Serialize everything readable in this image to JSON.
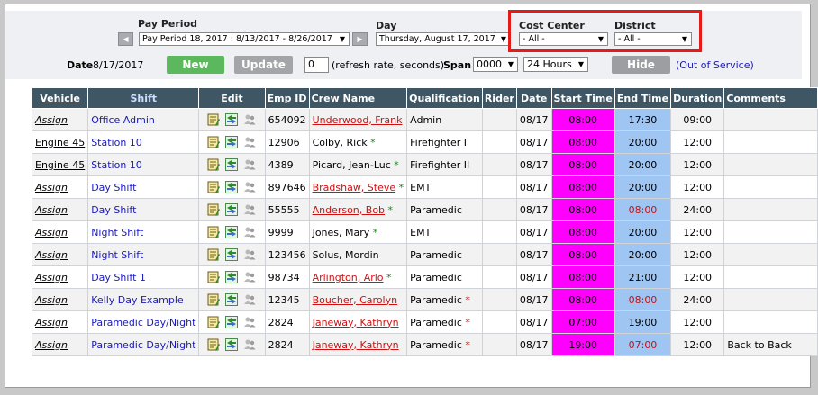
{
  "colors": {
    "start_bg": "#ff00ff",
    "end_bg": "#9fc5f2",
    "header_bg": "#3f5665",
    "accent_red": "#e31b1b"
  },
  "filters": {
    "pay_period_label": "Pay Period",
    "pay_period_value": "Pay Period 18, 2017 : 8/13/2017 - 8/26/2017",
    "day_label": "Day",
    "day_value": "Thursday, August 17, 2017",
    "cost_center_label": "Cost Center",
    "cost_center_value": "- All -",
    "district_label": "District",
    "district_value": "- All -",
    "prev_icon": "left-arrow-icon",
    "next_icon": "right-arrow-icon"
  },
  "controls": {
    "date_label": "Date",
    "date_value": "8/17/2017",
    "new_label": "New",
    "update_label": "Update",
    "refresh_value": "0",
    "refresh_text": "(refresh rate, seconds)",
    "span_label": "Span",
    "span_time": "0000",
    "span_hours": "24 Hours",
    "hide_label": "Hide",
    "out_of_service": "(Out of Service)"
  },
  "table": {
    "headers": [
      "Vehicle",
      "Shift",
      "Edit",
      "Emp ID",
      "Crew Name",
      "Qualification",
      "Rider",
      "Date",
      "Start Time",
      "End Time",
      "Duration",
      "Comments"
    ],
    "rows": [
      {
        "vehicle": "Assign",
        "shift": "Office Admin",
        "emp": "654092",
        "crew": "Underwood, Frank",
        "star": "",
        "qual": "Admin",
        "qstar": "",
        "date": "08/17",
        "start": "08:00",
        "end": "17:30",
        "dur": "09:00",
        "comment": ""
      },
      {
        "vehicle": "Engine 45",
        "shift": "Station 10",
        "emp": "12906",
        "crew": "Colby, Rick",
        "star": "*",
        "qual": "Firefighter I",
        "qstar": "",
        "date": "08/17",
        "start": "08:00",
        "end": "20:00",
        "dur": "12:00",
        "comment": ""
      },
      {
        "vehicle": "Engine 45",
        "shift": "Station 10",
        "emp": "4389",
        "crew": "Picard, Jean-Luc",
        "star": "*",
        "qual": "Firefighter II",
        "qstar": "",
        "date": "08/17",
        "start": "08:00",
        "end": "20:00",
        "dur": "12:00",
        "comment": ""
      },
      {
        "vehicle": "Assign",
        "shift": "Day Shift",
        "emp": "897646",
        "crew": "Bradshaw, Steve",
        "star": "*",
        "qual": "EMT",
        "qstar": "",
        "date": "08/17",
        "start": "08:00",
        "end": "20:00",
        "dur": "12:00",
        "comment": ""
      },
      {
        "vehicle": "Assign",
        "shift": "Day Shift",
        "emp": "55555",
        "crew": "Anderson, Bob",
        "star": "*",
        "qual": "Paramedic",
        "qstar": "",
        "date": "08/17",
        "start": "08:00",
        "end": "08:00",
        "dur": "24:00",
        "comment": ""
      },
      {
        "vehicle": "Assign",
        "shift": "Night Shift",
        "emp": "9999",
        "crew": "Jones, Mary",
        "star": "*",
        "qual": "EMT",
        "qstar": "",
        "date": "08/17",
        "start": "08:00",
        "end": "20:00",
        "dur": "12:00",
        "comment": ""
      },
      {
        "vehicle": "Assign",
        "shift": "Night Shift",
        "emp": "123456",
        "crew": "Solus, Mordin",
        "star": "",
        "qual": "Paramedic",
        "qstar": "",
        "date": "08/17",
        "start": "08:00",
        "end": "20:00",
        "dur": "12:00",
        "comment": ""
      },
      {
        "vehicle": "Assign",
        "shift": "Day Shift 1",
        "emp": "98734",
        "crew": "Arlington, Arlo",
        "star": "*",
        "qual": "Paramedic",
        "qstar": "",
        "date": "08/17",
        "start": "08:00",
        "end": "21:00",
        "dur": "12:00",
        "comment": ""
      },
      {
        "vehicle": "Assign",
        "shift": "Kelly Day Example",
        "emp": "12345",
        "crew": "Boucher, Carolyn",
        "star": "",
        "qual": "Paramedic",
        "qstar": "*",
        "date": "08/17",
        "start": "08:00",
        "end": "08:00",
        "dur": "24:00",
        "comment": ""
      },
      {
        "vehicle": "Assign",
        "shift": "Paramedic Day/Night",
        "emp": "2824",
        "crew": "Janeway, Kathryn",
        "star": "",
        "qual": "Paramedic",
        "qstar": "*",
        "date": "08/17",
        "start": "07:00",
        "end": "19:00",
        "dur": "12:00",
        "comment": ""
      },
      {
        "vehicle": "Assign",
        "shift": "Paramedic Day/Night",
        "emp": "2824",
        "crew": "Janeway, Kathryn",
        "star": "",
        "qual": "Paramedic",
        "qstar": "*",
        "date": "08/17",
        "start": "19:00",
        "end": "07:00",
        "dur": "12:00",
        "comment": "Back to Back"
      }
    ]
  }
}
